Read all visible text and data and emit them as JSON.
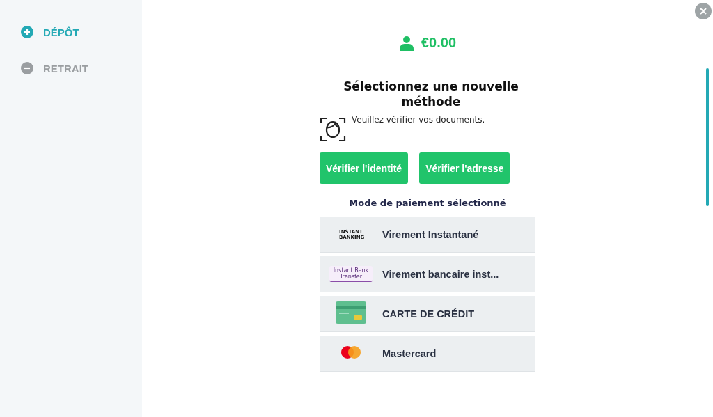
{
  "sidebar": {
    "items": [
      {
        "label": "DÉPÔT",
        "kind": "plus",
        "selected": true
      },
      {
        "label": "RETRAIT",
        "kind": "minus",
        "selected": false
      }
    ]
  },
  "balance": "€0.00",
  "heading": "Sélectionnez une nouvelle méthode",
  "notice": "Veuillez vérifier vos documents.",
  "buttons": [
    "Vérifier l'identité",
    "Vérifier l'adresse"
  ],
  "methods_title": "Mode de paiement sélectionné",
  "methods": [
    {
      "label": "Virement Instantané",
      "kind": "instant",
      "logo_text": "INSTANT BANKING"
    },
    {
      "label": "Virement bancaire inst...",
      "kind": "transfer",
      "logo_text": "Instant Bank Transfer"
    },
    {
      "label": "CARTE DE CRÉDIT",
      "kind": "card"
    },
    {
      "label": "Mastercard",
      "kind": "mastercard"
    }
  ]
}
